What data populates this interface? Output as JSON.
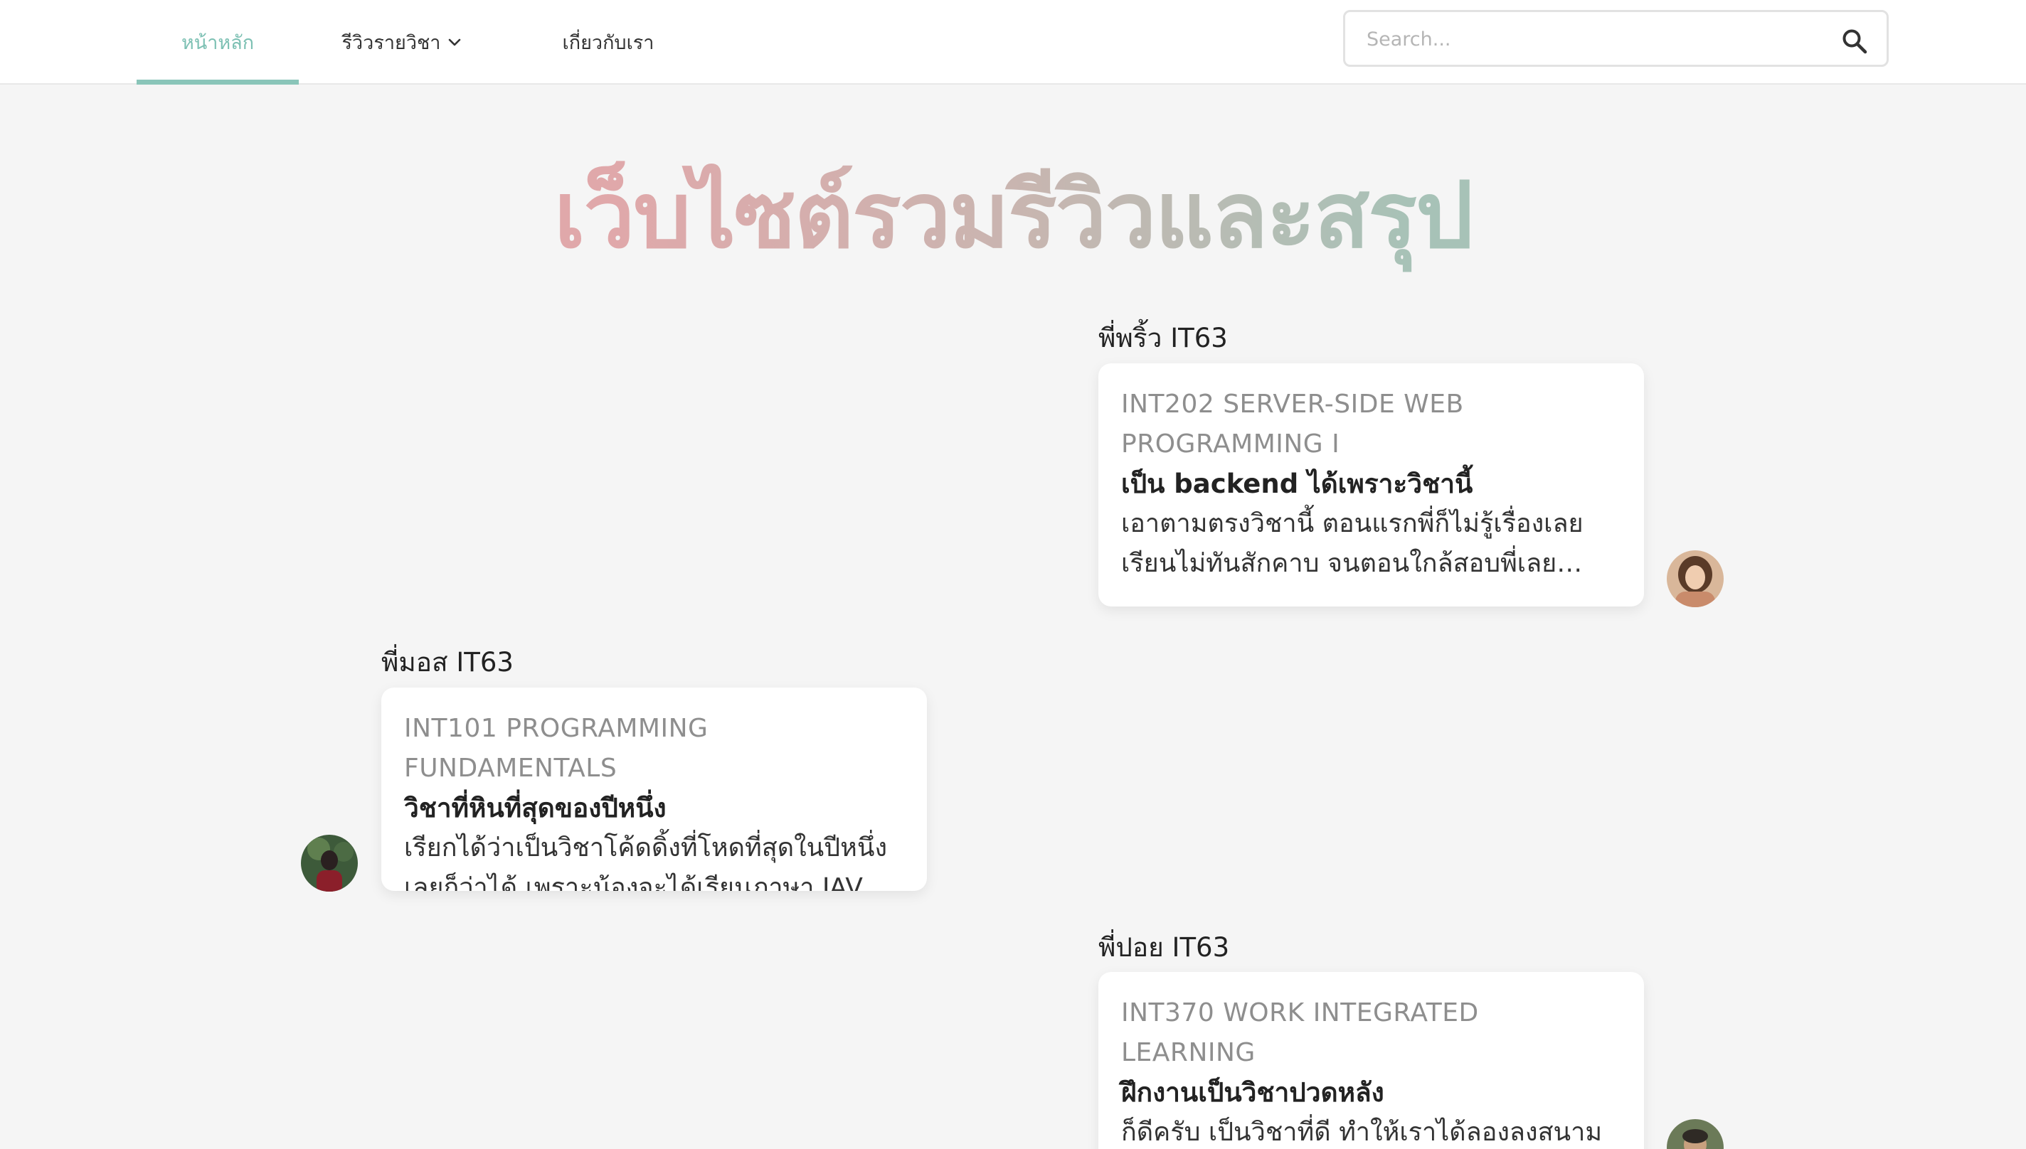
{
  "nav": {
    "home_label": "หน้าหลัก",
    "reviews_label": "รีวิวรายวิชา",
    "about_label": "เกี่ยวกับเรา",
    "search_placeholder": "Search...",
    "accent_color": "#7cc0b3"
  },
  "hero": {
    "title": "เว็บไซต์รวมรีวิวและสรุป"
  },
  "reviews": [
    {
      "author": "พี่พริ้ว IT63",
      "code": "INT202 SERVER-SIDE WEB PROGRAMMING I",
      "title": "เป็น backend ได้เพราะวิชานี้",
      "body": "เอาตามตรงวิชานี้ ตอนแรกพี่ก็ไม่รู้เรื่องเลย เรียนไม่ทันสักคาบ จนตอนใกล้สอบพี่เลยแบบ..."
    },
    {
      "author": "พี่มอส IT63",
      "code": "INT101 PROGRAMMING FUNDAMENTALS",
      "title": "วิชาที่หินที่สุดของปีหนึ่ง",
      "body": "เรียกได้ว่าเป็นวิชาโค้ดดิ้งที่โหดที่สุดในปีหนึ่งเลยก็ว่าได้ เพราะน้องจะได้เรียนภาษา JAVA ตั้งแต่..."
    },
    {
      "author": "พี่ปอย IT63",
      "code": "INT370 WORK INTEGRATED LEARNING",
      "title": "ฝึกงานเป็นวิชาปวดหลัง",
      "body": "ก็ดีครับ เป็นวิชาที่ดี ทำให้เราได้ลองลงสนาม จริง ได้นำความรู้มาทำงานจริง และหา..."
    }
  ]
}
